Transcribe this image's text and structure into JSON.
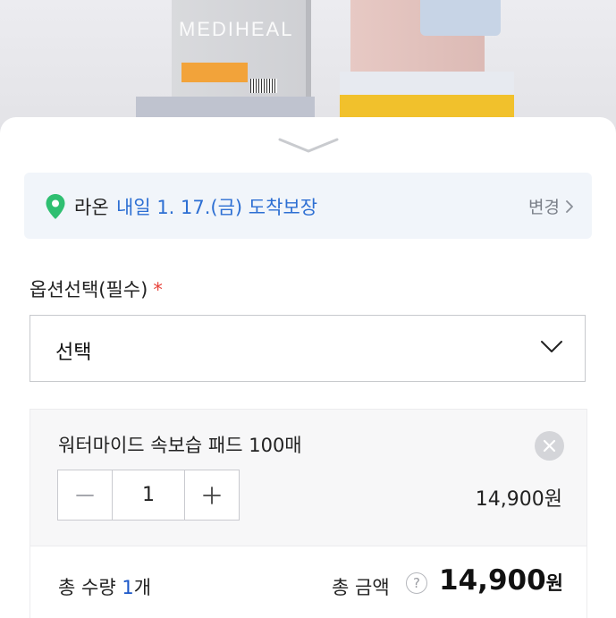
{
  "product_image": {
    "brand_text": "MEDIHEAL"
  },
  "delivery": {
    "name": "라온",
    "date_text": "내일 1. 17.(금) 도착보장",
    "change_label": "변경",
    "icons": {
      "location": "location-pin-icon",
      "change": "chevron-right-icon"
    },
    "accent_color": "#2d6fd3",
    "pin_color": "#2fbf71"
  },
  "options": {
    "title": "옵션선택(필수)",
    "required_mark": "*",
    "select_value": "선택"
  },
  "selected_item": {
    "name": "워터마이드 속보습 패드 100매",
    "quantity": "1",
    "price": "14,900원",
    "icons": {
      "remove": "close-icon",
      "decrease": "minus-icon",
      "increase": "plus-icon"
    }
  },
  "totals": {
    "qty_prefix": "총 수량 ",
    "qty_value": "1",
    "qty_suffix": "개",
    "amount_label": "총 금액",
    "help_symbol": "?",
    "amount_value": "14,900",
    "amount_unit": "원"
  }
}
